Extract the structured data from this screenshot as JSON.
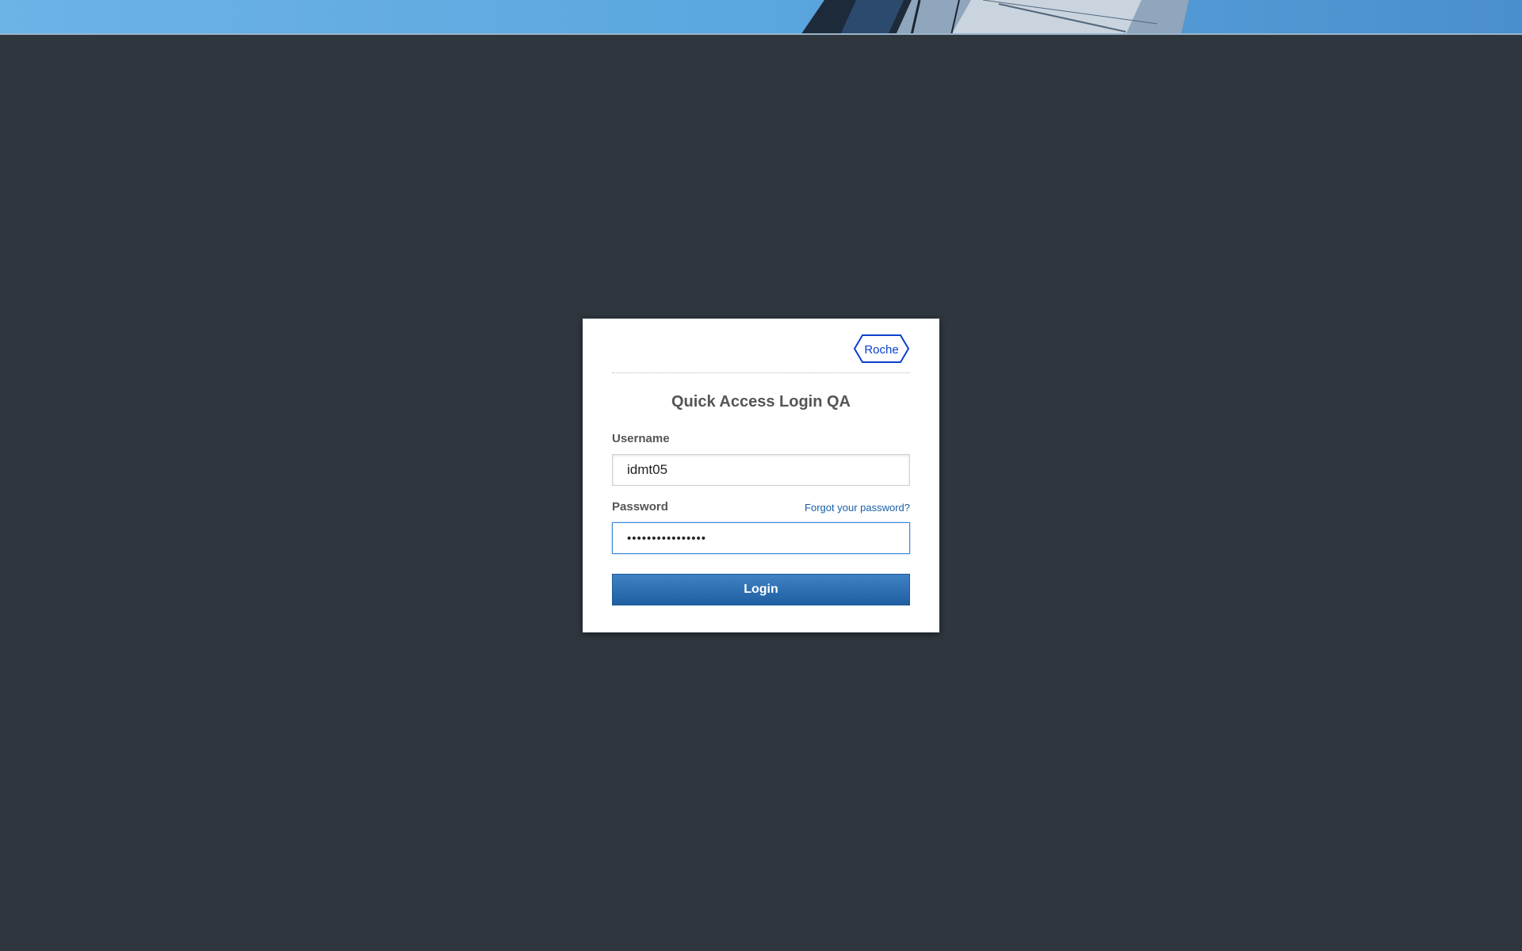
{
  "brand": {
    "logo_text": "Roche",
    "logo_color": "#0b41cd"
  },
  "login": {
    "title": "Quick Access Login QA",
    "username_label": "Username",
    "username_value": "idmt05",
    "password_label": "Password",
    "password_value": "••••••••••••••••",
    "forgot_password_link": "Forgot your password?",
    "login_button": "Login"
  },
  "colors": {
    "background": "#2f363e",
    "button": "#2a6db2",
    "link": "#1a5fa8",
    "focus_border": "#3a8ad6"
  }
}
